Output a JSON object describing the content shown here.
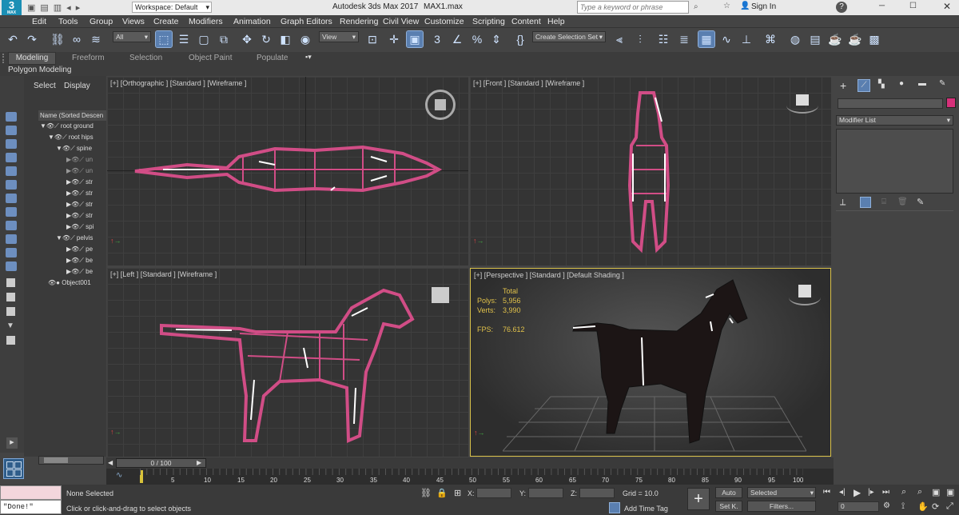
{
  "titlebar": {
    "app_icon_label": "3",
    "app_icon_sub": "MAX",
    "workspace": "Workspace: Default",
    "title": "Autodesk 3ds Max 2017",
    "filename": "MAX1.max",
    "search_placeholder": "Type a keyword or phrase",
    "signin": "Sign In"
  },
  "menu": [
    "Edit",
    "Tools",
    "Group",
    "Views",
    "Create",
    "Modifiers",
    "Animation",
    "Graph Editors",
    "Rendering",
    "Civil View",
    "Customize",
    "Scripting",
    "Content",
    "Help"
  ],
  "toolbar": {
    "filter": "All",
    "view": "View",
    "selection_set": "Create Selection Set"
  },
  "ribbon": {
    "tabs": [
      "Modeling",
      "Freeform",
      "Selection",
      "Object Paint",
      "Populate"
    ],
    "sub": "Polygon Modeling"
  },
  "scene": {
    "tabs": [
      "Select",
      "Display"
    ],
    "header": "Name (Sorted Descen",
    "rows": [
      "root ground",
      "root hips",
      "spine",
      "un",
      "un",
      "str",
      "str",
      "str",
      "str",
      "spi",
      "pelvis",
      "pe",
      "be",
      "be",
      "Object001"
    ]
  },
  "viewports": {
    "top": "[+] [Orthographic ] [Standard ] [Wireframe ]",
    "front": "[+] [Front ] [Standard ] [Wireframe ]",
    "left": "[+] [Left ] [Standard ] [Wireframe ]",
    "persp": "[+] [Perspective ] [Standard ] [Default Shading ]"
  },
  "stats": {
    "total": "Total",
    "polys_label": "Polys:",
    "polys": "5,956",
    "verts_label": "Verts:",
    "verts": "3,990",
    "fps_label": "FPS:",
    "fps": "76.612"
  },
  "command_panel": {
    "modifier_list": "Modifier List"
  },
  "timeline": {
    "frame": "0 / 100",
    "ticks": [
      "5",
      "10",
      "15",
      "20",
      "25",
      "30",
      "35",
      "40",
      "45",
      "50",
      "55",
      "60",
      "65",
      "70",
      "75",
      "80",
      "85",
      "90",
      "95",
      "100"
    ]
  },
  "status": {
    "maxscript": "\"Done!\"",
    "selected": "None Selected",
    "prompt": "Click or click-and-drag to select objects",
    "x_label": "X:",
    "y_label": "Y:",
    "z_label": "Z:",
    "grid": "Grid = 10.0",
    "add_time_tag": "Add Time Tag",
    "auto": "Auto",
    "set_k": "Set K.",
    "selected_dd": "Selected",
    "filters": "Filters...",
    "frame_field": "0"
  },
  "colors": {
    "wire": "#d14d86",
    "accent": "#5a7fb0"
  }
}
